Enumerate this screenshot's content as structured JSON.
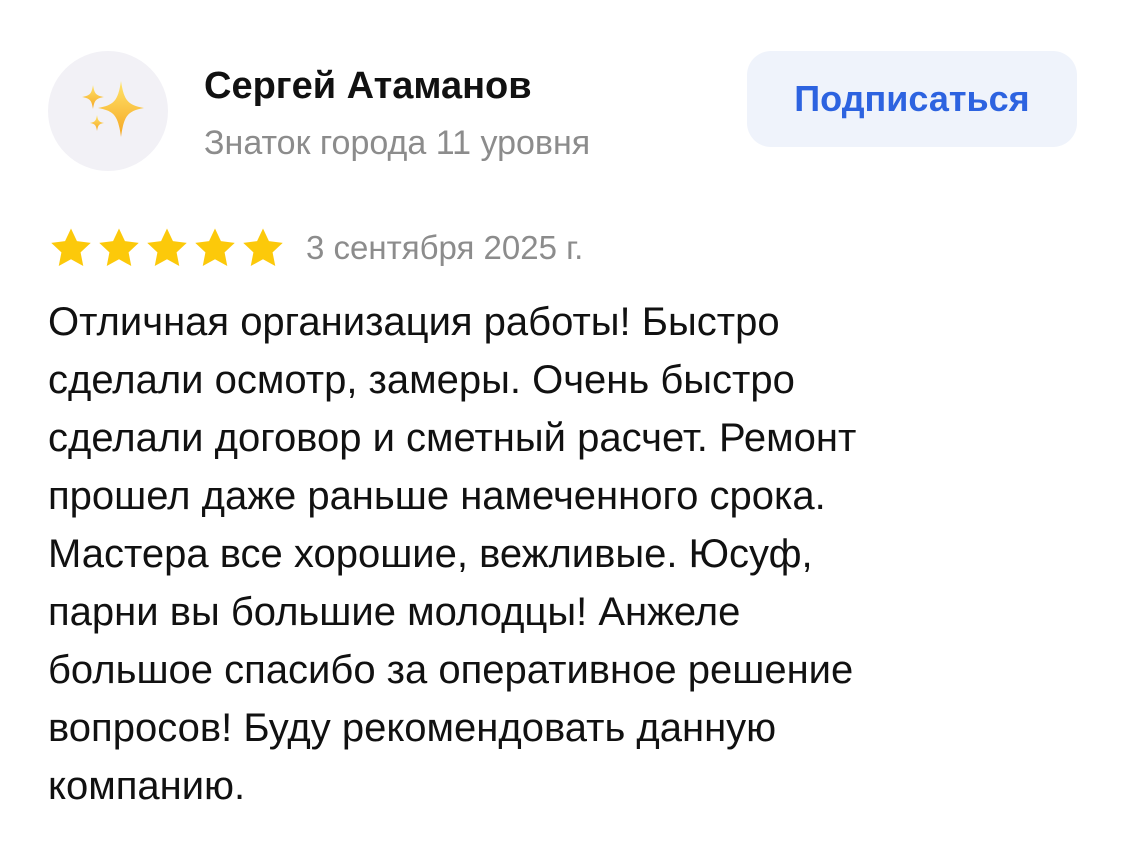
{
  "author": {
    "name": "Сергей Атаманов",
    "level": "Знаток города 11 уровня",
    "avatar_icon": "sparkles-icon"
  },
  "subscribe": {
    "label": "Подписаться"
  },
  "review": {
    "rating": 5,
    "max_rating": 5,
    "date": "3 сентября 2025 г.",
    "text": "Отличная организация работы! Быстро\nсделали осмотр, замеры. Очень быстро\nсделали договор и сметный расчет. Ремонт\nпрошел даже раньше намеченного срока.\nМастера все хорошие, вежливые.  Юсуф,\nпарни вы большие молодцы! Анжеле\nбольшое спасибо за оперативное решение\nвопросов! Буду рекомендовать данную\nкомпанию."
  },
  "colors": {
    "accent": "#2d63e0",
    "star": "#fcc90a",
    "secondary_text": "#8c8c8c",
    "button_bg": "#eff3fb",
    "avatar_bg": "#f2f1f6"
  }
}
